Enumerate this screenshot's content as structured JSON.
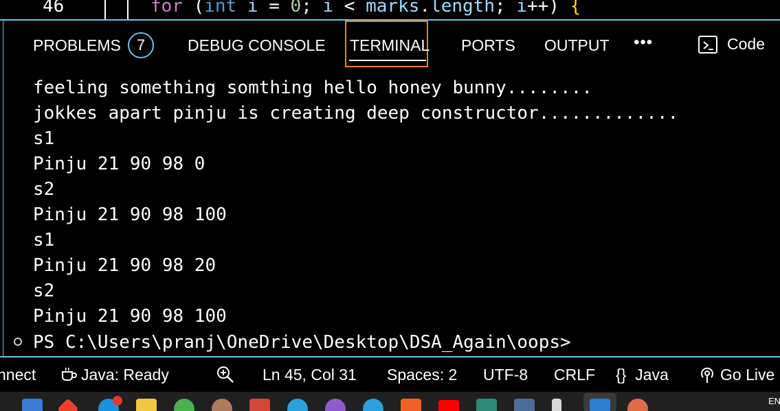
{
  "editor": {
    "line_number": "46",
    "code": {
      "kw_for": "for",
      "open_paren": " (",
      "type_int": "int",
      "var_i1": " i",
      "eq": " = ",
      "zero": "0",
      "semi1": "; ",
      "var_i2": "i",
      "lt": " < ",
      "marks": "marks",
      "dot": ".",
      "length": "length",
      "semi2": "; ",
      "var_i3": "i",
      "inc": "++",
      "close_paren": ") ",
      "brace": "{"
    }
  },
  "panel": {
    "tabs": {
      "problems": "PROBLEMS",
      "problems_count": "7",
      "debug_console": "DEBUG CONSOLE",
      "terminal": "TERMINAL",
      "ports": "PORTS",
      "output": "OUTPUT",
      "more": "•••",
      "code": "Code"
    },
    "active_tab": "TERMINAL"
  },
  "terminal": {
    "lines": [
      "feeling something somthing hello honey bunny........",
      "jokkes apart pinju is creating deep constructor.............",
      "s1",
      "Pinju 21 90 98 0",
      "s2",
      "Pinju 21 90 98 100",
      "s1",
      "Pinju 21 90 98 20",
      "s2",
      "Pinju 21 90 98 100"
    ],
    "prompt": "PS C:\\Users\\pranj\\OneDrive\\Desktop\\DSA_Again\\oops>"
  },
  "statusbar": {
    "connect": "nnect",
    "java_ready": "Java: Ready",
    "line_col": "Ln 45, Col 31",
    "spaces": "Spaces: 2",
    "encoding": "UTF-8",
    "eol": "CRLF",
    "language_icon": "{}",
    "language": "Java",
    "go_live": "Go Live"
  },
  "taskbar": {
    "lang": "EN",
    "icons": [
      "store-icon",
      "office-icon",
      "edge-icon",
      "folder-icon",
      "chrome-icon",
      "photo-icon",
      "gmail-icon",
      "telegram-icon",
      "edge-profile-icon",
      "edge-dev-icon",
      "brave-icon",
      "youtube-icon",
      "chatgpt-icon",
      "app-icon",
      "rocket-icon",
      "vscode-icon",
      "media-icon"
    ]
  },
  "colors": {
    "accent_border": "#6fc3df",
    "active_tab_outline": "#f38518",
    "background": "#000000"
  }
}
